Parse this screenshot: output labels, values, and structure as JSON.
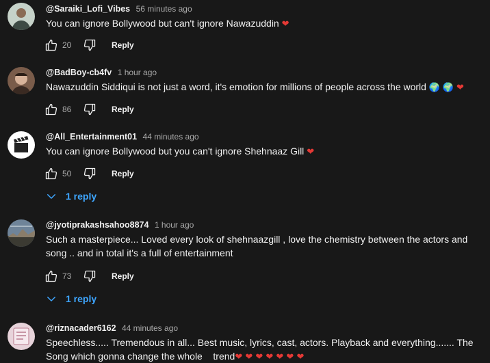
{
  "comments": [
    {
      "handle": "@Saraiki_Lofi_Vibes",
      "time": "56 minutes ago",
      "text": "You can ignore Bollywood but can't ignore Nawazuddin",
      "emoji": "❤",
      "likes": "20",
      "reply_label": "Reply",
      "avatar_icon": "portrait-photo",
      "avatar_color": "#9aa7a0"
    },
    {
      "handle": "@BadBoy-cb4fv",
      "time": "1 hour ago",
      "text": "Nawazuddin Siddiqui is not just a word, it's emotion for millions of people across the world",
      "emoji_globe1": "🌍",
      "emoji_globe2": "🌍",
      "emoji": "❤",
      "likes": "86",
      "reply_label": "Reply",
      "avatar_icon": "portrait-photo",
      "avatar_color": "#b49a86"
    },
    {
      "handle": "@All_Entertainment01",
      "time": "44 minutes ago",
      "text": "You can ignore Bollywood but you can't ignore Shehnaaz Gill",
      "emoji": "❤",
      "likes": "50",
      "reply_label": "Reply",
      "replies_label": "1 reply",
      "avatar_icon": "film-clapper",
      "avatar_color": "#ffffff"
    },
    {
      "handle": "@jyotiprakashsahoo8874",
      "time": "1 hour ago",
      "text_line1": "Such a masterpiece... Loved every look of shehnaazgill ,  love the chemistry between the actors and",
      "text_line2": "song .. and in total it's a full of entertainment",
      "likes": "73",
      "reply_label": "Reply",
      "replies_label": "1 reply",
      "avatar_icon": "landscape-photo",
      "avatar_color": "#5a6a7a"
    },
    {
      "handle": "@riznacader6162",
      "time": "44 minutes ago",
      "text_line1": "Speechless..... Tremendous in all... Best music, lyrics, cast, actors. Playback and everything....... The",
      "text_line2": "Song which gonna change the whole    trend",
      "emoji_hearts": "❤ ❤ ❤ ❤ ❤ ❤ ❤",
      "avatar_icon": "pink-card",
      "avatar_color": "#e8c9d3"
    }
  ],
  "colors": {
    "background": "#181818",
    "text": "#f1f1f1",
    "secondary": "#aaaaaa",
    "link": "#3ea6ff",
    "heart": "#e53935"
  }
}
